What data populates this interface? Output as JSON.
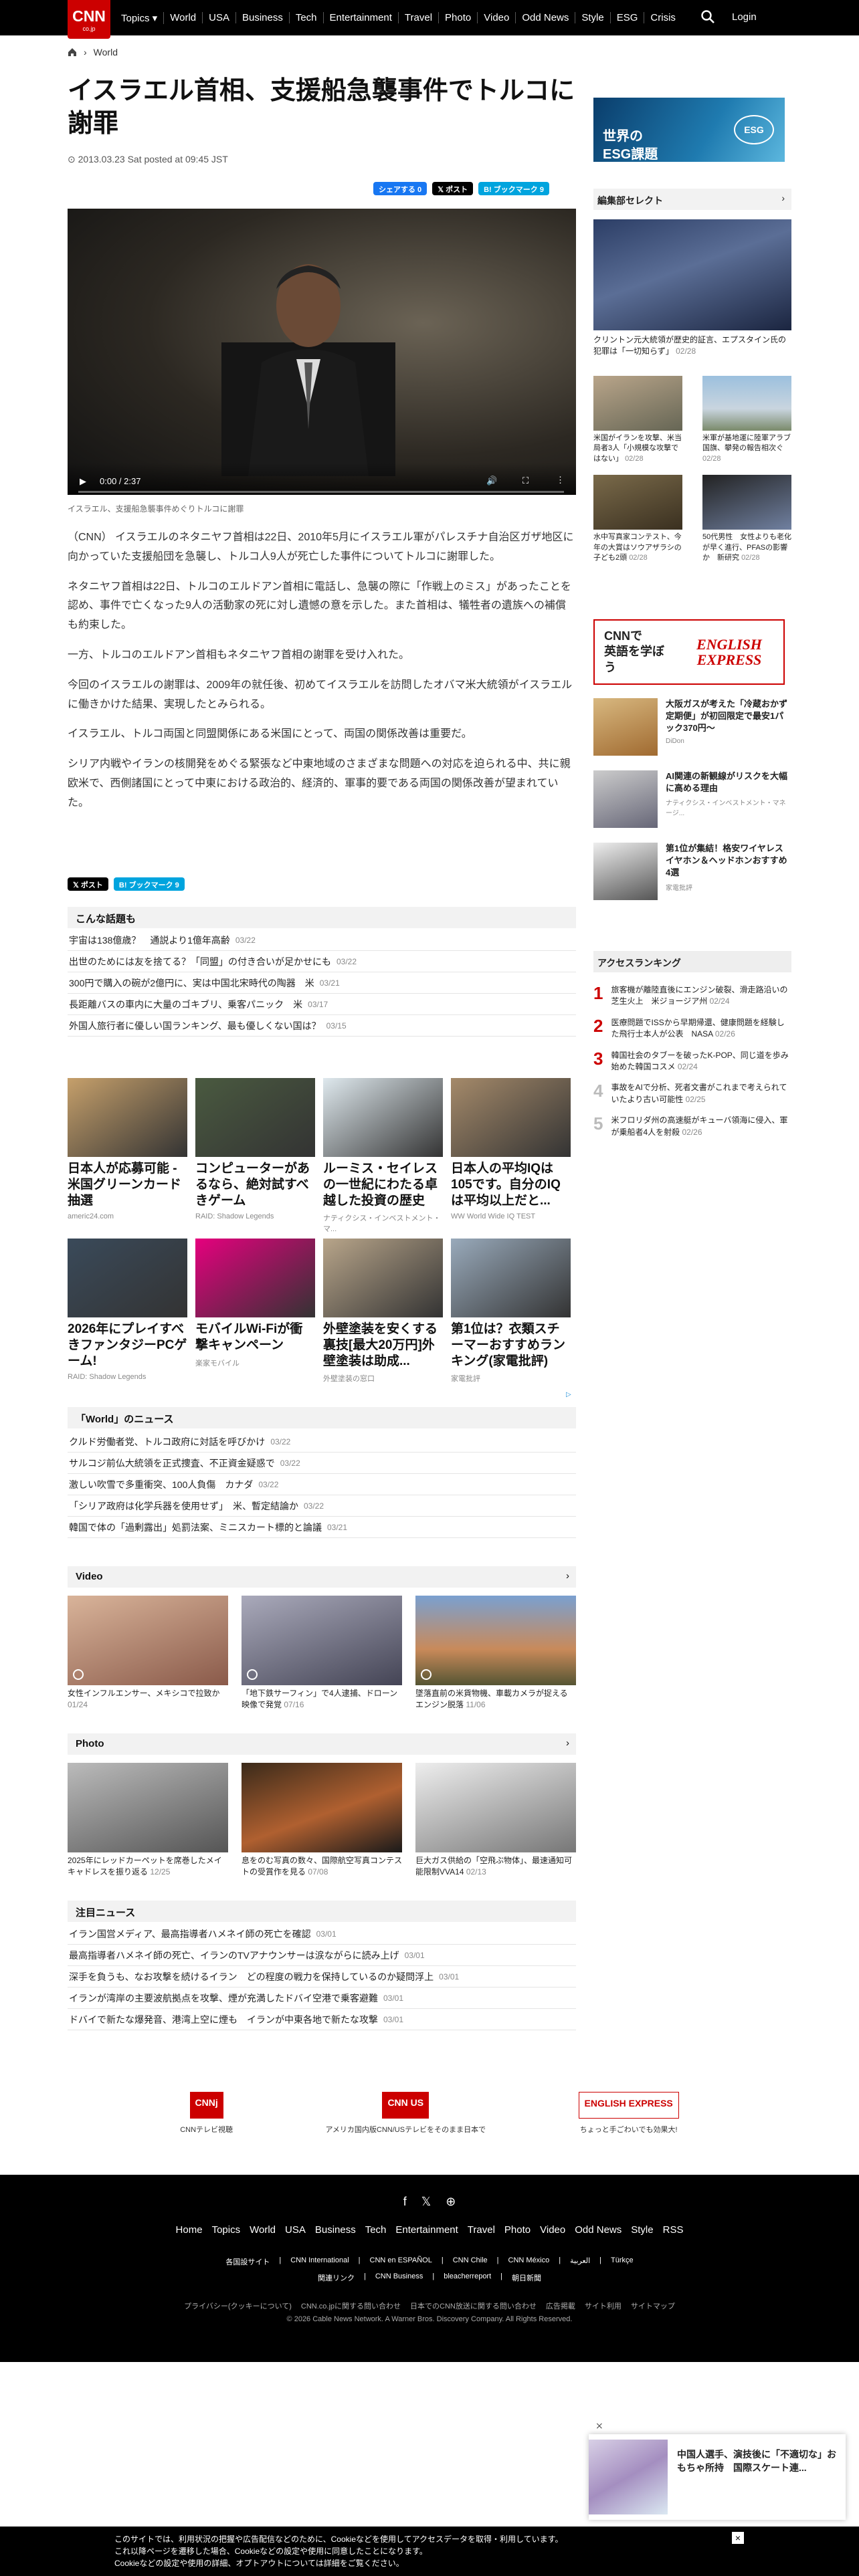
{
  "brand": {
    "logo": "CNN",
    "logo_sub": "co.jp"
  },
  "nav": {
    "items": [
      "Topics ▾",
      "World",
      "USA",
      "Business",
      "Tech",
      "Entertainment",
      "Travel",
      "Photo",
      "Video",
      "Odd News",
      "Style",
      "ESG",
      "Crisis"
    ],
    "login": "Login"
  },
  "breadcrumb": {
    "section": "World"
  },
  "article": {
    "title": "イスラエル首相、支援船急襲事件でトルコに謝罪",
    "date": "2013.03.23 Sat posted at 09:45 JST",
    "video_time": "0:00 / 2:37",
    "caption": "イスラエル、支援船急襲事件めぐりトルコに謝罪",
    "paragraphs": [
      "（CNN） イスラエルのネタニヤフ首相は22日、2010年5月にイスラエル軍がパレスチナ自治区ガザ地区に向かっていた支援船団を急襲し、トルコ人9人が死亡した事件についてトルコに謝罪した。",
      "ネタニヤフ首相は22日、トルコのエルドアン首相に電話し、急襲の際に「作戦上のミス」があったことを認め、事件で亡くなった9人の活動家の死に対し遺憾の意を示した。また首相は、犠牲者の遺族への補償も約束した。",
      "一方、トルコのエルドアン首相もネタニヤフ首相の謝罪を受け入れた。",
      "今回のイスラエルの謝罪は、2009年の就任後、初めてイスラエルを訪問したオバマ米大統領がイスラエルに働きかけた結果、実現したとみられる。",
      "イスラエル、トルコ両国と同盟関係にある米国にとって、両国の関係改善は重要だ。",
      "シリア内戦やイランの核開発をめぐる緊張など中東地域のさまざまな問題への対応を迫られる中、共に親欧米で、西側諸国にとって中東における政治的、経済的、軍事的要である両国の関係改善が望まれていた。"
    ]
  },
  "share": {
    "fb": "シェアする 0",
    "x": "ポスト",
    "hb": "ブックマーク 9"
  },
  "related": {
    "heading": "こんな話題も",
    "items": [
      {
        "t": "宇宙は138億歳？　通説より1億年高齢",
        "d": "03/22"
      },
      {
        "t": "出世のためには友を捨てる？「同盟」の付き合いが足かせにも",
        "d": "03/22"
      },
      {
        "t": "300円で購入の碗が2億円に、実は中国北宋時代の陶器　米",
        "d": "03/21"
      },
      {
        "t": "長距離バスの車内に大量のゴキブリ、乗客パニック　米",
        "d": "03/17"
      },
      {
        "t": "外国人旅行者に優しい国ランキング、最も優しくない国は？",
        "d": "03/15"
      }
    ]
  },
  "ads1": [
    {
      "t": "日本人が応募可能 - 米国グリーンカード抽選",
      "s": "americ24.com",
      "c": "#c6a06b"
    },
    {
      "t": "コンピューターがあるなら、絶対試すべきゲーム",
      "s": "RAID: Shadow Legends",
      "c": "#4a5a40"
    },
    {
      "t": "ルーミス・セイレスの一世紀にわたる卓越した投資の歴史",
      "s": "ナティクシス・インベストメント・マ...",
      "c": "#dfe9ee"
    },
    {
      "t": "日本人の平均IQは105です。自分のIQは平均以上だと...",
      "s": "WW World Wide IQ TEST",
      "c": "#a58a6a"
    }
  ],
  "ads2": [
    {
      "t": "2026年にプレイすべきファンタジーPCゲーム!",
      "s": "RAID: Shadow Legends",
      "c": "#3a4a5a"
    },
    {
      "t": "モバイルWi-Fiが衝撃キャンペーン",
      "s": "楽家モバイル",
      "c": "#e6007e"
    },
    {
      "t": "外壁塗装を安くする裏技[最大20万円]外壁塗装は助成...",
      "s": "外壁塗装の窓口",
      "c": "#b8a58a"
    },
    {
      "t": "第1位は？衣類スチーマーおすすめランキング(家電批評)",
      "s": "家電批評",
      "c": "#9ab"
    }
  ],
  "world": {
    "heading": "「World」のニュース",
    "items": [
      {
        "t": "クルド労働者党、トルコ政府に対話を呼びかけ",
        "d": "03/22"
      },
      {
        "t": "サルコジ前仏大統領を正式捜査、不正資金疑惑で",
        "d": "03/22"
      },
      {
        "t": "激しい吹雪で多重衝突、100人負傷　カナダ",
        "d": "03/22"
      },
      {
        "t": "「シリア政府は化学兵器を使用せず」　米、暫定結論か",
        "d": "03/22"
      },
      {
        "t": "韓国で体の「過剰露出」処罰法案、ミニスカート標的と論議",
        "d": "03/21"
      }
    ]
  },
  "video": {
    "heading": "Video",
    "items": [
      {
        "c": "女性インフルエンサー、メキシコで拉致か",
        "d": "01/24"
      },
      {
        "c": "「地下鉄サーフィン」で4人逮捕、ドローン映像で発覚",
        "d": "07/16"
      },
      {
        "c": "墜落直前の米貨物機、車載カメラが捉える　エンジン脱落",
        "d": "11/06"
      }
    ]
  },
  "photo": {
    "heading": "Photo",
    "items": [
      {
        "c": "2025年にレッドカーペットを席巻したメイキャドレスを振り返る",
        "d": "12/25"
      },
      {
        "c": "息をのむ写真の数々、国際航空写真コンテストの受賞作を見る",
        "d": "07/08"
      },
      {
        "c": "巨大ガス供給の「空飛ぶ物体」、最速通知可能限制VVA14",
        "d": "02/13"
      }
    ]
  },
  "attention": {
    "heading": "注目ニュース",
    "items": [
      {
        "t": "イラン国営メディア、最高指導者ハメネイ師の死亡を確認",
        "d": "03/01"
      },
      {
        "t": "最高指導者ハメネイ師の死亡、イランのTVアナウンサーは涙ながらに読み上げ",
        "d": "03/01"
      },
      {
        "t": "深手を負うも、なお攻撃を続けるイラン　どの程度の戦力を保持しているのか疑問浮上",
        "d": "03/01"
      },
      {
        "t": "イランが湾岸の主要波航拠点を攻撃、煙が充満したドバイ空港で乗客避難",
        "d": "03/01"
      },
      {
        "t": "ドバイで新たな爆発音、港湾上空に煙も　イランが中東各地で新たな攻撃",
        "d": "03/01"
      }
    ]
  },
  "right": {
    "esg": "世界の\nESG課題",
    "editor": "編集部セレクト",
    "top": {
      "c": "クリントン元大統領が歴史的証言、エプスタイン氏の犯罪は「一切知らず」",
      "d": "02/28"
    },
    "mini": [
      {
        "c": "米国がイランを攻撃、米当局者3人「小規模な攻撃ではない」",
        "d": "02/28"
      },
      {
        "c": "米軍が基地運に陸軍アラブ国旗、攀発の報告相次ぐ",
        "d": "02/28"
      },
      {
        "c": "水中写真家コンテスト、今年の大賞はソウアザラシの子ども2頭",
        "d": "02/28"
      },
      {
        "c": "50代男性　女性よりも老化が早く進行、PFASの影響か　新研究",
        "d": "02/28"
      }
    ],
    "banner_left": "CNNで\n英語を学ぼう",
    "banner_right": "ENGLISH\nEXPRESS",
    "ads": [
      {
        "t": "大阪ガスが考えた「冷蔵おかず定期便」が初回限定で最安1パック370円～",
        "s": "DiDon"
      },
      {
        "t": "AI関連の新観線がリスクを大幅に高める理由",
        "s": "ナティクシス・インベストメント・マネージ..."
      },
      {
        "t": "第1位が集結！格安ワイヤレスイヤホン＆ヘッドホンおすすめ4選",
        "s": "家電批評"
      }
    ],
    "ranking_heading": "アクセスランキング",
    "ranking": [
      {
        "n": "1",
        "t": "旅客機が離陸直後にエンジン破裂、滑走路沿いの芝生火上　米ジョージア州",
        "d": "02/24"
      },
      {
        "n": "2",
        "t": "医療問題でISSから早期帰還、健康問題を経験した飛行士本人が公表　NASA",
        "d": "02/26"
      },
      {
        "n": "3",
        "t": "韓国社会のタブーを破ったK-POP、同じ道を歩み始めた韓国コスメ",
        "d": "02/24"
      },
      {
        "n": "4",
        "t": "事故をAIで分析、死者文書がこれまで考えられていたより古い可能性",
        "d": "02/25"
      },
      {
        "n": "5",
        "t": "米フロリダ州の高速艇がキューバ領海に侵入、軍が乗船者4人を射殺",
        "d": "02/26"
      }
    ]
  },
  "footer_services": [
    {
      "t": "CNNテレビ視聴",
      "b": "CNNj"
    },
    {
      "t": "アメリカ国内版CNN/USテレビをそのまま日本で",
      "b": "CNN US"
    },
    {
      "t": "ちょっと手ごわいでも効果大!",
      "b": "ENGLISH EXPRESS"
    }
  ],
  "footer": {
    "nav": [
      "Home",
      "Topics",
      "World",
      "USA",
      "Business",
      "Tech",
      "Entertainment",
      "Travel",
      "Photo",
      "Video",
      "Odd News",
      "Style",
      "RSS"
    ],
    "sites": [
      "各国設サイト",
      "CNN International",
      "CNN en ESPAÑOL",
      "CNN Chile",
      "CNN México",
      "العربية",
      "Türkçe"
    ],
    "sites2": [
      "関連リンク",
      "CNN Business",
      "bleacherreport",
      "朝日新聞"
    ],
    "legal": [
      "プライバシー(クッキーについて)",
      "CNN.co.jpに関する問い合わせ",
      "日本でのCNN放送に関する問い合わせ",
      "広告掲載",
      "サイト利用",
      "サイトマップ"
    ],
    "copyright": "© 2026 Cable News Network. A Warner Bros. Discovery Company. All Rights Reserved."
  },
  "toast": {
    "t": "中国人選手、演技後に「不適切な」おもちゃ所持　国際スケート連..."
  },
  "cookie": {
    "l1": "このサイトでは、利用状況の把握や広告配信などのために、Cookieなどを使用してアクセスデータを取得・利用しています。",
    "l2": "これ以降ページを遷移した場合、Cookieなどの設定や使用に同意したことになります。",
    "l3": "Cookieなどの設定や使用の詳細、オプトアウトについては詳細をご覧ください。"
  }
}
